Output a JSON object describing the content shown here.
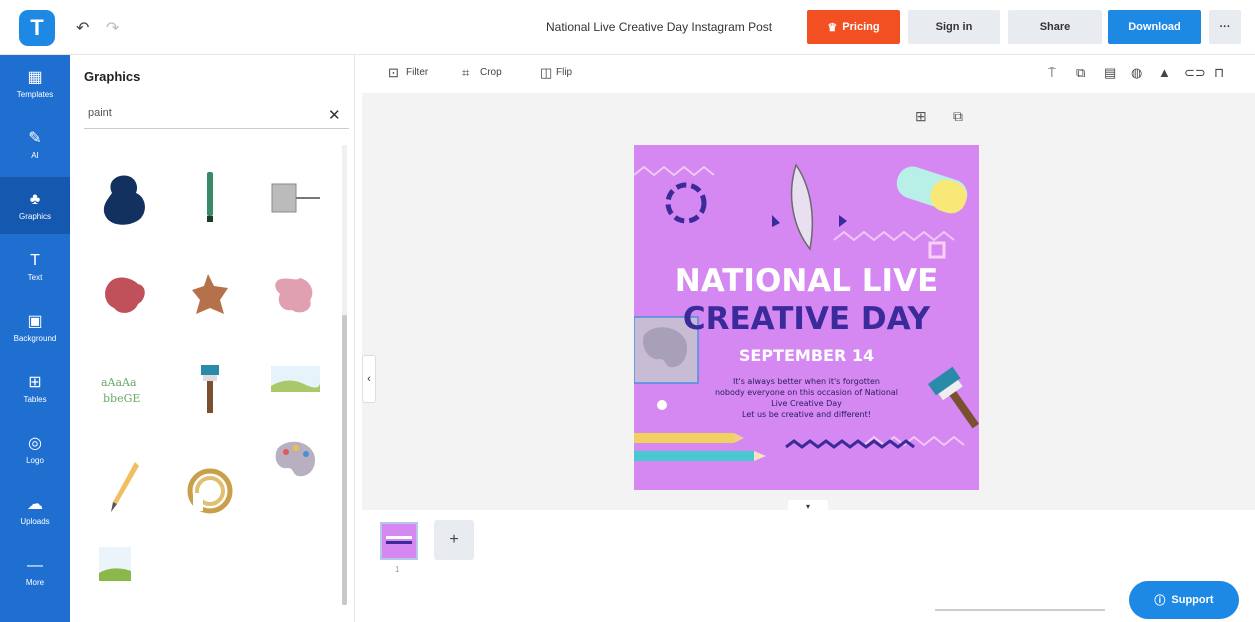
{
  "header": {
    "logo_letter": "T",
    "undo_icon": "↶",
    "redo_icon": "↷",
    "doc_title": "National Live Creative Day Instagram Post",
    "pricing_label": "Pricing",
    "signin_label": "Sign in",
    "share_label": "Share",
    "download_label": "Download",
    "more_label": "···"
  },
  "sidebar": {
    "items": [
      {
        "label": "Templates",
        "icon": "▦"
      },
      {
        "label": "AI",
        "icon": "✎"
      },
      {
        "label": "Graphics",
        "icon": "♣"
      },
      {
        "label": "Text",
        "icon": "T"
      },
      {
        "label": "Background",
        "icon": "▣"
      },
      {
        "label": "Tables",
        "icon": "⊞"
      },
      {
        "label": "Logo",
        "icon": "◎"
      },
      {
        "label": "Uploads",
        "icon": "☁"
      },
      {
        "label": "More",
        "icon": "—"
      }
    ]
  },
  "panel": {
    "title": "Graphics",
    "search_value": "paint",
    "clear_icon": "✕"
  },
  "editbar": {
    "filter_label": "Filter",
    "crop_label": "Crop",
    "flip_label": "Flip"
  },
  "poster": {
    "title_line1": "NATIONAL LIVE",
    "title_line2": "CREATIVE DAY",
    "date": "SEPTEMBER 14",
    "body_line1": "It's always better when it's forgotten",
    "body_line2": "nobody everyone on this occasion of National",
    "body_line3": "Live Creative Day",
    "body_line4": "Let us be creative and different!"
  },
  "pages": {
    "add_label": "+",
    "page_number": "1"
  },
  "support_label": "Support",
  "colors": {
    "brand_blue": "#1e88e5",
    "nav_blue": "#1e6fd0",
    "pricing_orange": "#f25022",
    "poster_purple": "#d587f2",
    "title_white": "#ffffff",
    "title_indigo": "#3a2a9a"
  }
}
